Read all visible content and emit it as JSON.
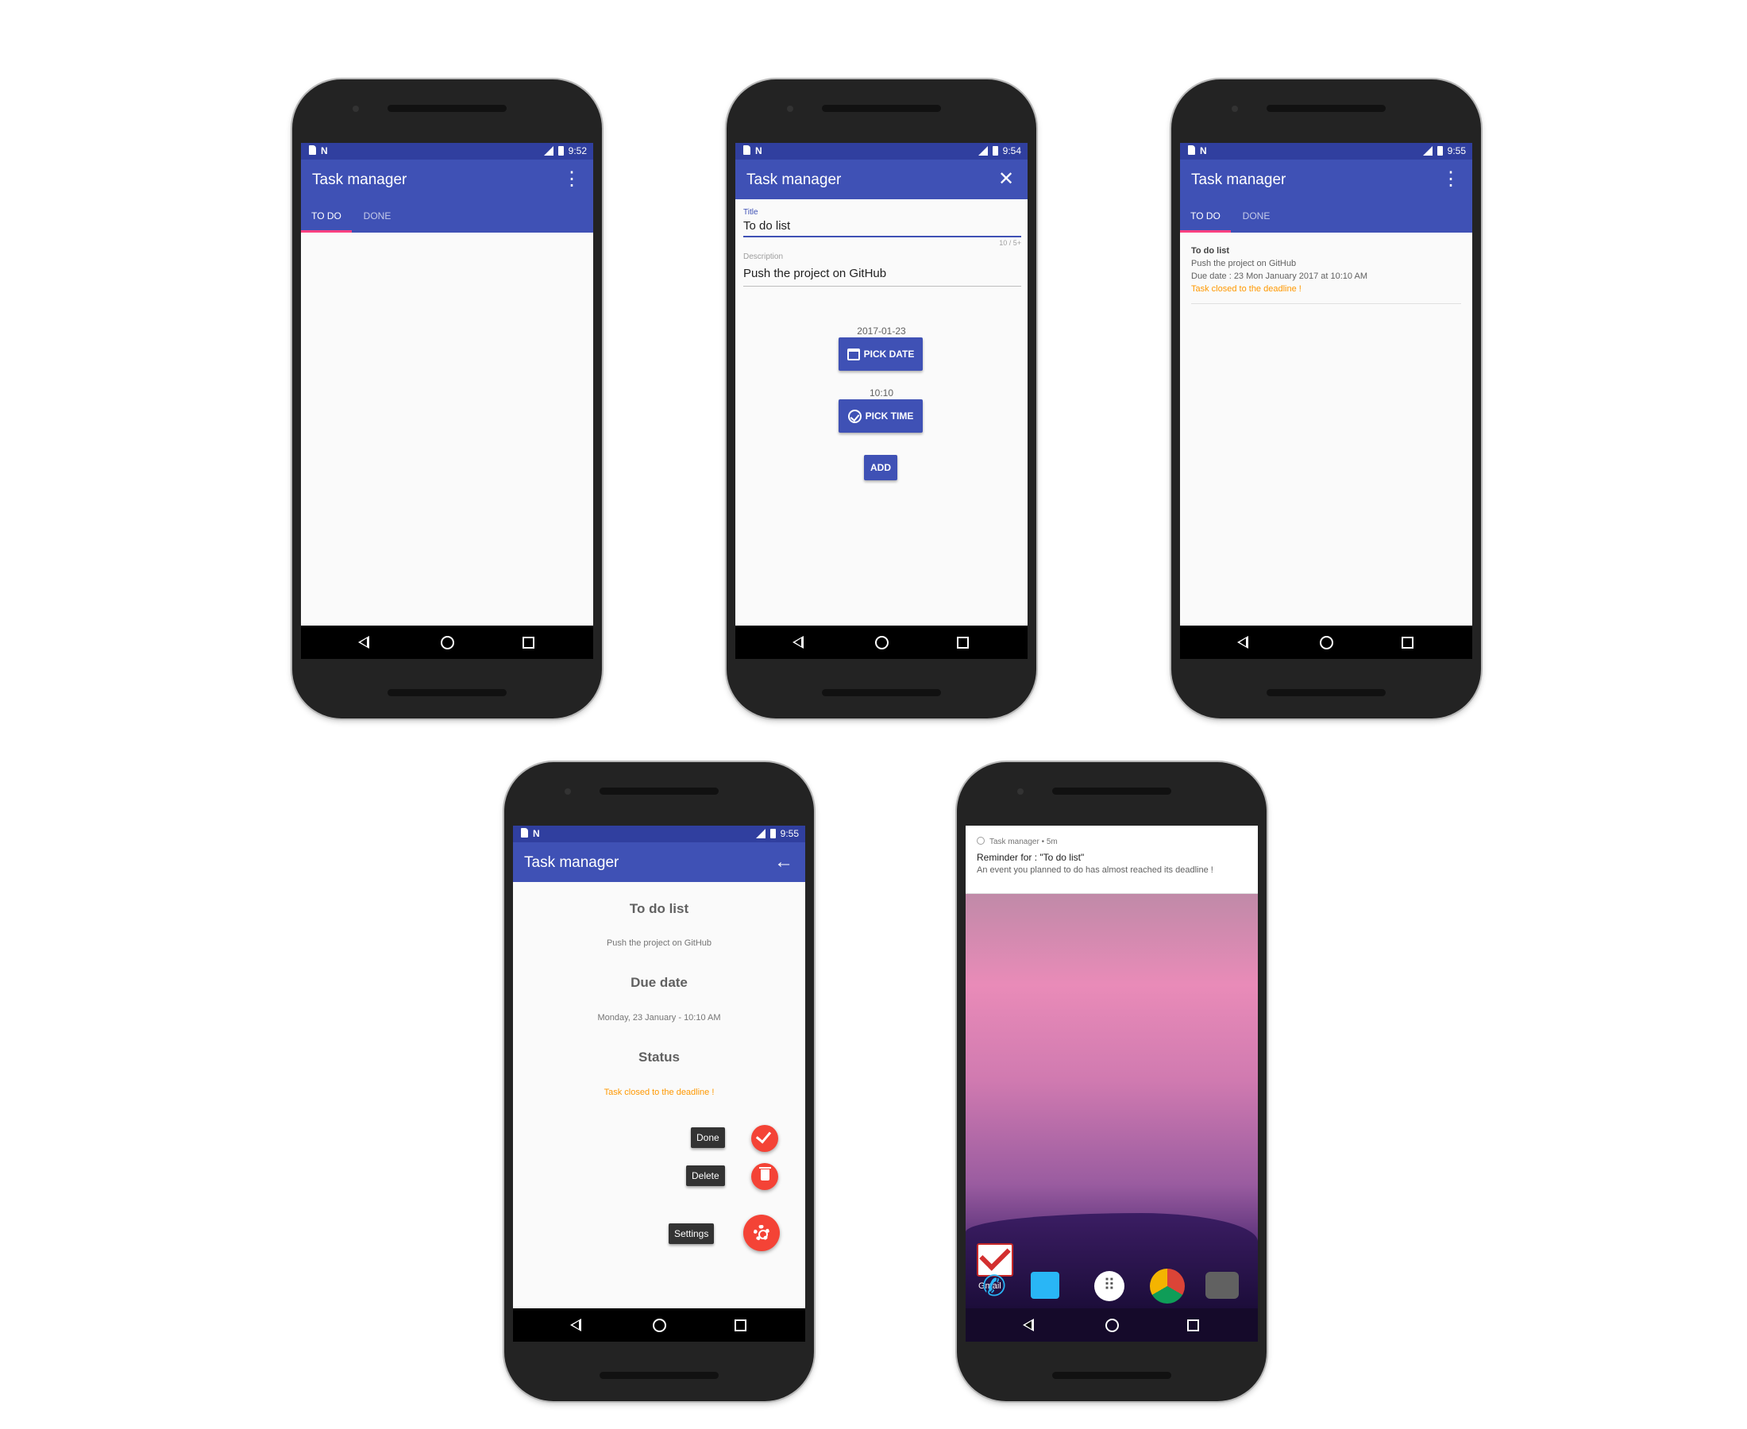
{
  "status_bar": {
    "time_1": "9:52",
    "time_2": "9:54",
    "time_3": "9:55",
    "time_4": "9:55"
  },
  "app": {
    "title": "Task manager"
  },
  "tabs": {
    "todo": "TO DO",
    "done": "DONE"
  },
  "add_form": {
    "title_label": "Title",
    "title_value": "To do list",
    "title_counter": "10 / 5+",
    "description_label": "Description",
    "description_value": "Push the project on GitHub",
    "date_value": "2017-01-23",
    "pick_date_label": "PICK DATE",
    "time_value": "10:10",
    "pick_time_label": "PICK TIME",
    "add_label": "ADD"
  },
  "task_list": {
    "items": [
      {
        "title": "To do list",
        "description": "Push the project on GitHub",
        "due": "Due date : 23 Mon January 2017 at 10:10 AM",
        "warning": "Task closed to the deadline !"
      }
    ]
  },
  "detail": {
    "title": "To do list",
    "description": "Push the project on GitHub",
    "due_heading": "Due date",
    "due_value": "Monday, 23 January - 10:10 AM",
    "status_heading": "Status",
    "status_value": "Task closed to the deadline !",
    "done_label": "Done",
    "delete_label": "Delete",
    "settings_label": "Settings"
  },
  "notification": {
    "app": "Task manager • 5m",
    "title": "Reminder for : \"To do list\"",
    "body": "An event you planned to do has almost reached its deadline !"
  },
  "home": {
    "gmail_label": "Gmail"
  },
  "colors": {
    "primary": "#3f51b5",
    "primary_dark": "#303f9f",
    "accent": "#ff4081",
    "warning": "#ff9800",
    "fab": "#f44336"
  }
}
